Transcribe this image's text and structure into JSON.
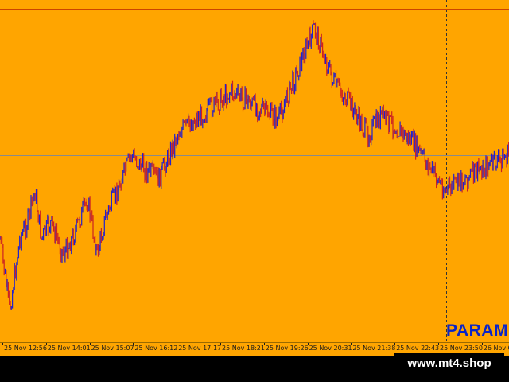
{
  "chart": {
    "background_color": "#FFA500",
    "up_color": "#2222cc",
    "down_color": "#cc2222",
    "horizontal_line_color": "#8a8a8a",
    "top_line_color": "#cc4400",
    "vertical_marker_style": "dashed",
    "overlay_text": "PARAM",
    "overlay_text_color": "#0a24c8",
    "time_labels": [
      "25 Nov 12:56",
      "25 Nov 14:01",
      "25 Nov 15:07",
      "25 Nov 16:12",
      "25 Nov 17:17",
      "25 Nov 18:21",
      "25 Nov 19:26",
      "25 Nov 20:31",
      "25 Nov 21:38",
      "25 Nov 22:43",
      "25 Nov 23:50",
      "26 Nov 0"
    ]
  },
  "watermark": {
    "text": "www.mt4.shop"
  },
  "chart_data": {
    "type": "line",
    "title": "",
    "xlabel": "",
    "ylabel": "",
    "x": [
      "25 Nov 12:56",
      "25 Nov 14:01",
      "25 Nov 15:07",
      "25 Nov 16:12",
      "25 Nov 17:17",
      "25 Nov 18:21",
      "25 Nov 19:26",
      "25 Nov 20:31",
      "25 Nov 21:38",
      "25 Nov 22:43",
      "25 Nov 23:50",
      "26 Nov 0"
    ],
    "series": [
      {
        "values": [
          300,
          390,
          300,
          280,
          240,
          300,
          280,
          320,
          290,
          250,
          320,
          275,
          240,
          195,
          215,
          225,
          165,
          140,
          115,
          150,
          35,
          105,
          130,
          170,
          145,
          180,
          240,
          215,
          195
        ]
      }
    ],
    "grid": false,
    "legend": "none"
  }
}
